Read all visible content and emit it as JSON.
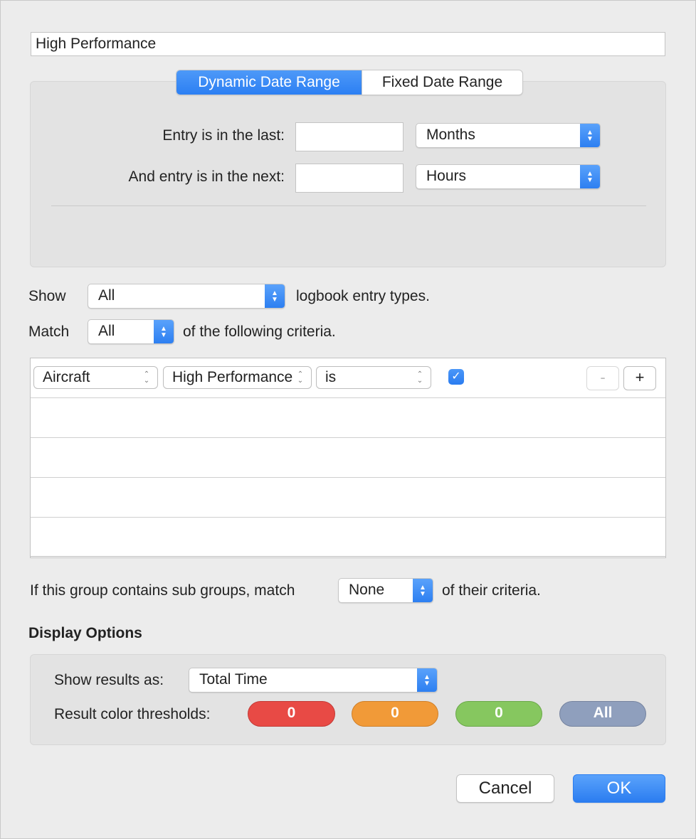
{
  "group_name": "High Performance",
  "date_range": {
    "tabs": [
      {
        "label": "Dynamic Date Range",
        "active": true
      },
      {
        "label": "Fixed Date Range",
        "active": false
      }
    ],
    "last_label": "Entry is in the last:",
    "last_value": "",
    "last_unit": "Months",
    "next_label": "And entry is in the next:",
    "next_value": "",
    "next_unit": "Hours"
  },
  "show": {
    "label": "Show",
    "value": "All",
    "suffix": "logbook entry types."
  },
  "match": {
    "label": "Match",
    "value": "All",
    "suffix": "of the following criteria."
  },
  "criteria": [
    {
      "field": "Aircraft",
      "property": "High Performance",
      "operator": "is",
      "checked": true
    }
  ],
  "criteria_buttons": {
    "remove": "-",
    "add": "+"
  },
  "subgroups": {
    "label": "If this group contains sub groups, match",
    "value": "None",
    "suffix": "of their criteria."
  },
  "display_options": {
    "title": "Display Options",
    "show_results_label": "Show results as:",
    "show_results_value": "Total Time",
    "thresholds_label": "Result color thresholds:",
    "thresholds": [
      {
        "value": "0",
        "color": "#e84a45"
      },
      {
        "value": "0",
        "color": "#f19a38"
      },
      {
        "value": "0",
        "color": "#86c75f"
      },
      {
        "value": "All",
        "color": "#8f9fbd"
      }
    ]
  },
  "actions": {
    "cancel": "Cancel",
    "ok": "OK"
  }
}
